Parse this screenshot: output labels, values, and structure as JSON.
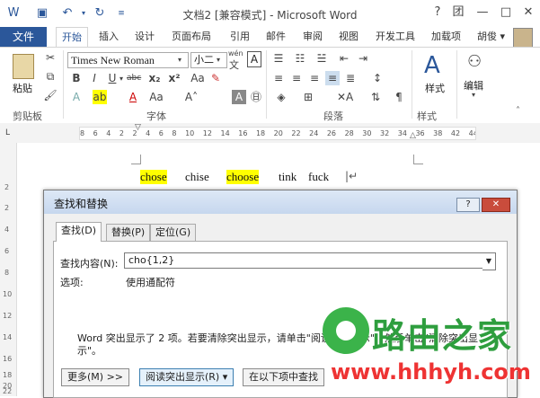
{
  "titlebar": {
    "title": "文档2 [兼容模式] - Microsoft Word",
    "help": "?",
    "options": "团",
    "minimize": "—",
    "maximize": "□",
    "close": "✕"
  },
  "tabs": {
    "file": "文件",
    "items": [
      "开始",
      "插入",
      "设计",
      "页面布局",
      "引用",
      "邮件",
      "审阅",
      "视图",
      "开发工具",
      "加载项"
    ],
    "active": "开始",
    "user": "胡俊 ▾"
  },
  "ribbon": {
    "paste": "粘贴",
    "font_name": "Times New Roman",
    "font_size": "小二",
    "wen": "wén",
    "wen2": "文",
    "styles": "样式",
    "editing": "编辑",
    "groups": {
      "clipboard": "剪贴板",
      "font": "字体",
      "paragraph": "段落",
      "styles": "样式"
    },
    "format_buttons": [
      "B",
      "I",
      "U",
      "abc",
      "x₂",
      "x²"
    ],
    "A_big": "A",
    "A_small": "A"
  },
  "ruler": {
    "ticks": "8 6 4 2 2 4 6 8 10 12 14 16 18 20 22 24 26 28 30 32 34 36 38 42 44 46 48",
    "vertical": [
      "2",
      "2",
      "4",
      "6",
      "8",
      "10",
      "12",
      "14",
      "16",
      "18",
      "20",
      "22"
    ]
  },
  "document": {
    "words": [
      "chose",
      "chise",
      "choose",
      "tink",
      "fuck"
    ]
  },
  "dialog": {
    "title": "查找和替换",
    "help": "?",
    "close": "✕",
    "tabs": [
      "查找(D)",
      "替换(P)",
      "定位(G)"
    ],
    "find_label": "查找内容(N):",
    "find_value": "cho{1,2}",
    "options_label": "选项:",
    "options_value": "使用通配符",
    "message": "Word 突出显示了 2 项。若要清除突出显示，请单击\"阅读突出显示\"，然后单击\"清除突出显示\"。",
    "buttons": {
      "more": "更多(M) >>",
      "reading_highlight": "阅读突出显示(R) ▾",
      "find_in": "在以下项中查找"
    }
  },
  "watermark": {
    "text": "路由之家",
    "url": "www.hhhyh.com"
  }
}
